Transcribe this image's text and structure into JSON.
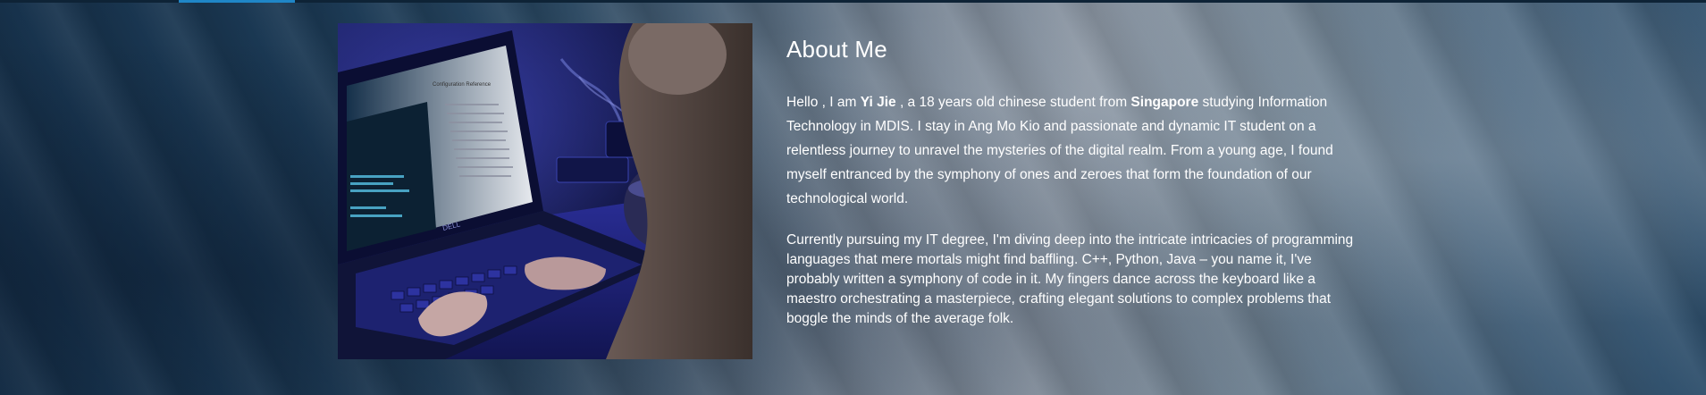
{
  "about": {
    "title": "About Me",
    "para1": {
      "hello": "Hello , I am ",
      "name": "Yi Jie",
      "mid": " ,  a 18 years old chinese  student from ",
      "country": "Singapore",
      "rest": " studying Information Technology in MDIS.  I stay in Ang Mo Kio and passionate and dynamic IT student on a relentless journey to unravel the mysteries of the digital realm. From a young age, I found myself entranced by the symphony of ones and zeroes that form the foundation of our technological world."
    },
    "para2": "Currently pursuing my IT degree, I'm diving deep into the intricate intricacies of programming languages that mere mortals might find baffling. C++, Python, Java – you name it, I've probably written a symphony of code in it. My fingers dance across the keyboard like a maestro orchestrating a masterpiece, crafting elegant solutions to complex problems that boggle the minds of the average folk."
  },
  "photo": {
    "laptop_brand": "DELL",
    "screen_heading": "Configuration Reference"
  },
  "colors": {
    "accent": "#1f86c7",
    "text": "#ffffff",
    "background": "#1a3248"
  }
}
